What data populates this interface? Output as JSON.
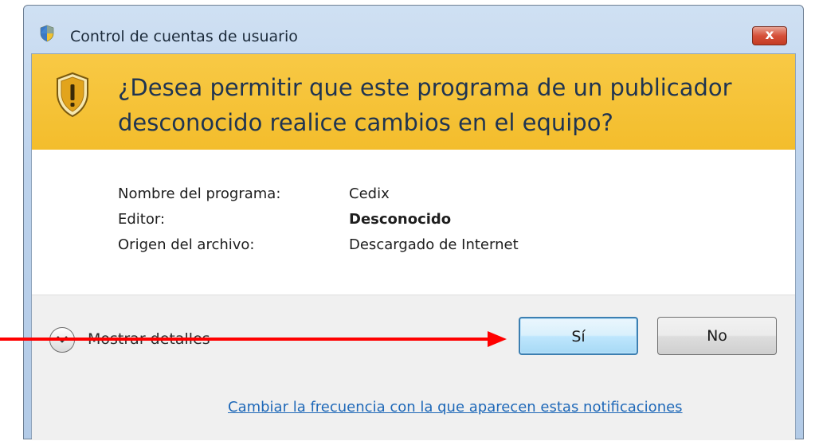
{
  "window": {
    "title": "Control de cuentas de usuario",
    "close_label": "x"
  },
  "banner": {
    "question": "¿Desea permitir que este programa de un publicador desconocido realice cambios en el equipo?"
  },
  "details": {
    "rows": [
      {
        "label": "Nombre del programa:",
        "value": "Cedix"
      },
      {
        "label": "Editor:",
        "value": "Desconocido"
      },
      {
        "label": "Origen del archivo:",
        "value": "Descargado de Internet"
      }
    ]
  },
  "footer": {
    "show_details": "Mostrar detalles",
    "yes_label": "Sí",
    "no_label": "No",
    "link": "Cambiar la frecuencia con la que aparecen estas notificaciones"
  },
  "colors": {
    "banner": "#f3bd2c",
    "annotation_arrow": "#ff0000",
    "link": "#1e68b8"
  },
  "icons": {
    "title": "uac-shield-icon",
    "banner": "warning-shield-icon",
    "expander": "chevron-down-icon"
  }
}
